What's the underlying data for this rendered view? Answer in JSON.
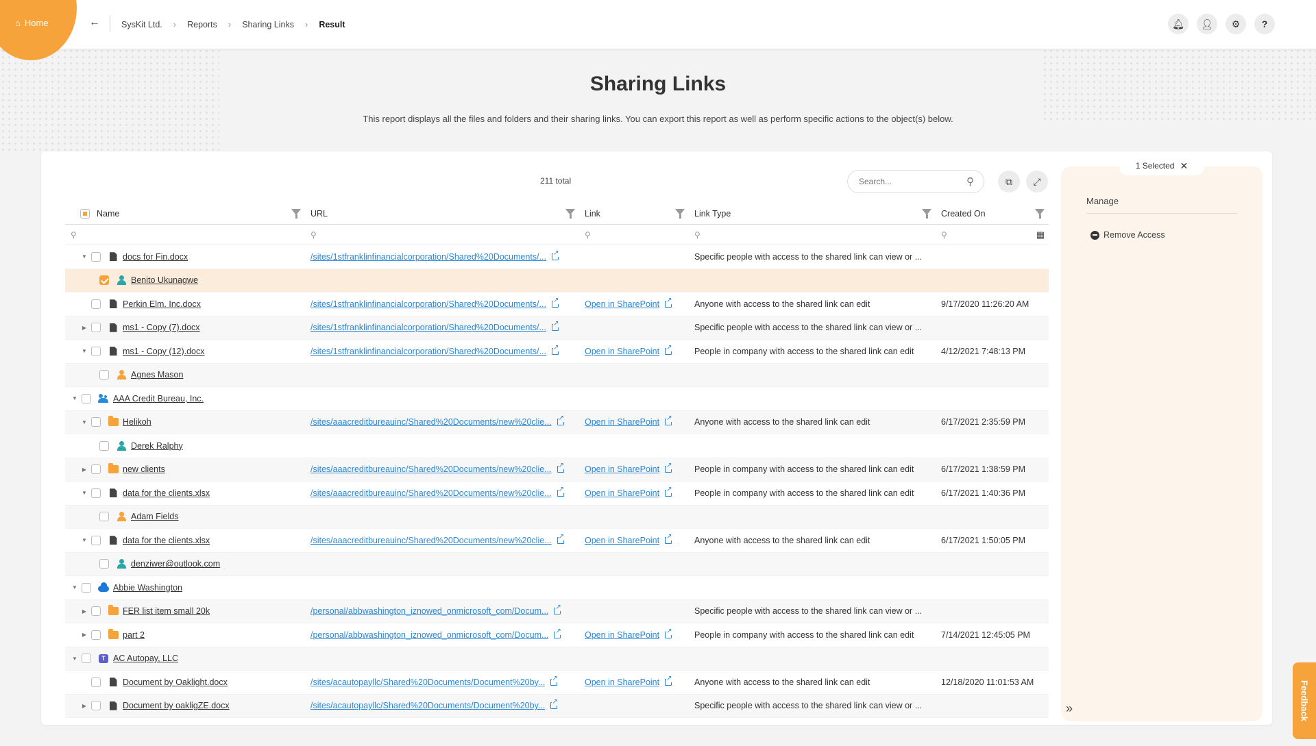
{
  "nav": {
    "home_label": "Home",
    "breadcrumb": [
      "SysKit Ltd.",
      "Reports",
      "Sharing Links",
      "Result"
    ]
  },
  "page": {
    "title": "Sharing Links",
    "description": "This report displays all the files and folders and their sharing links. You can export this report as well as perform specific actions to the object(s) below."
  },
  "toolbar": {
    "total": "211 total",
    "search_placeholder": "Search..."
  },
  "table": {
    "columns": [
      "Name",
      "URL",
      "Link",
      "Link Type",
      "Created On"
    ],
    "rows": [
      {
        "level": 1,
        "caret": "▼",
        "icon": "file",
        "name": "docs for Fin.docx",
        "url": "/sites/1stfranklinfinancialcorporation/Shared%20Documents/...",
        "link": "",
        "type": "Specific people with access to the shared link can view or ...",
        "date": "",
        "style": "normal"
      },
      {
        "level": 2,
        "caret": "",
        "icon": "user-teal",
        "name": "Benito Ukunagwe",
        "url": "",
        "link": "",
        "type": "",
        "date": "",
        "style": "sel",
        "checked": true
      },
      {
        "level": 1,
        "caret": "",
        "icon": "file",
        "name": "Perkin Elm. Inc.docx",
        "url": "/sites/1stfranklinfinancialcorporation/Shared%20Documents/...",
        "link": "Open in SharePoint",
        "type": "Anyone with access to the shared link can edit",
        "date": "9/17/2020 11:26:20 AM",
        "style": "normal"
      },
      {
        "level": 1,
        "caret": "▶",
        "icon": "file",
        "name": "ms1 - Copy (7).docx",
        "url": "/sites/1stfranklinfinancialcorporation/Shared%20Documents/...",
        "link": "",
        "type": "Specific people with access to the shared link can view or ...",
        "date": "",
        "style": "alt"
      },
      {
        "level": 1,
        "caret": "▼",
        "icon": "file",
        "name": "ms1 - Copy (12).docx",
        "url": "/sites/1stfranklinfinancialcorporation/Shared%20Documents/...",
        "link": "Open in SharePoint",
        "type": "People in company with access to the shared link can edit",
        "date": "4/12/2021 7:48:13 PM",
        "style": "normal"
      },
      {
        "level": 2,
        "caret": "",
        "icon": "user-orange",
        "name": "Agnes Mason",
        "url": "",
        "link": "",
        "type": "",
        "date": "",
        "style": "alt"
      },
      {
        "level": 0,
        "caret": "▼",
        "icon": "group",
        "name": "AAA Credit Bureau, Inc.",
        "url": "",
        "link": "",
        "type": "",
        "date": "",
        "style": "normal"
      },
      {
        "level": 1,
        "caret": "▼",
        "icon": "folder",
        "name": "Helikoh",
        "url": "/sites/aaacreditbureauinc/Shared%20Documents/new%20clie...",
        "link": "Open in SharePoint",
        "type": "Anyone with access to the shared link can edit",
        "date": "6/17/2021 2:35:59 PM",
        "style": "alt"
      },
      {
        "level": 2,
        "caret": "",
        "icon": "user-teal",
        "name": "Derek Ralphy",
        "url": "",
        "link": "",
        "type": "",
        "date": "",
        "style": "normal"
      },
      {
        "level": 1,
        "caret": "▶",
        "icon": "folder",
        "name": "new clients",
        "url": "/sites/aaacreditbureauinc/Shared%20Documents/new%20clie...",
        "link": "Open in SharePoint",
        "type": "People in company with access to the shared link can edit",
        "date": "6/17/2021 1:38:59 PM",
        "style": "alt"
      },
      {
        "level": 1,
        "caret": "▼",
        "icon": "file",
        "name": "data for the clients.xlsx",
        "url": "/sites/aaacreditbureauinc/Shared%20Documents/new%20clie...",
        "link": "Open in SharePoint",
        "type": "People in company with access to the shared link can edit",
        "date": "6/17/2021 1:40:36 PM",
        "style": "normal"
      },
      {
        "level": 2,
        "caret": "",
        "icon": "user-orange",
        "name": "Adam Fields",
        "url": "",
        "link": "",
        "type": "",
        "date": "",
        "style": "alt"
      },
      {
        "level": 1,
        "caret": "▼",
        "icon": "file",
        "name": "data for the clients.xlsx",
        "url": "/sites/aaacreditbureauinc/Shared%20Documents/new%20clie...",
        "link": "Open in SharePoint",
        "type": "Anyone with access to the shared link can edit",
        "date": "6/17/2021 1:50:05 PM",
        "style": "normal"
      },
      {
        "level": 2,
        "caret": "",
        "icon": "user-teal",
        "name": "denziwer@outlook.com",
        "url": "",
        "link": "",
        "type": "",
        "date": "",
        "style": "alt"
      },
      {
        "level": 0,
        "caret": "▼",
        "icon": "cloud",
        "name": "Abbie Washington",
        "url": "",
        "link": "",
        "type": "",
        "date": "",
        "style": "normal"
      },
      {
        "level": 1,
        "caret": "▶",
        "icon": "folder",
        "name": "FER list item small 20k",
        "url": "/personal/abbwashington_iznowed_onmicrosoft_com/Docum...",
        "link": "",
        "type": "Specific people with access to the shared link can view or ...",
        "date": "",
        "style": "alt"
      },
      {
        "level": 1,
        "caret": "▶",
        "icon": "folder",
        "name": "part 2",
        "url": "/personal/abbwashington_iznowed_onmicrosoft_com/Docum...",
        "link": "Open in SharePoint",
        "type": "People in company with access to the shared link can edit",
        "date": "7/14/2021 12:45:05 PM",
        "style": "normal"
      },
      {
        "level": 0,
        "caret": "▼",
        "icon": "teams",
        "name": "AC Autopay, LLC",
        "url": "",
        "link": "",
        "type": "",
        "date": "",
        "style": "alt"
      },
      {
        "level": 1,
        "caret": "",
        "icon": "file",
        "name": "Document by Oaklight.docx",
        "url": "/sites/acautopayllc/Shared%20Documents/Document%20by...",
        "link": "Open in SharePoint",
        "type": "Anyone with access to the shared link can edit",
        "date": "12/18/2020 11:01:53 AM",
        "style": "normal"
      },
      {
        "level": 1,
        "caret": "▶",
        "icon": "file",
        "name": "Document by oakligZE.docx",
        "url": "/sites/acautopayllc/Shared%20Documents/Document%20by...",
        "link": "",
        "type": "Specific people with access to the shared link can view or ...",
        "date": "",
        "style": "alt"
      }
    ]
  },
  "side_panel": {
    "selected_label": "1 Selected",
    "manage_heading": "Manage",
    "remove_access_label": "Remove Access"
  },
  "feedback_label": "Feedback",
  "colors": {
    "accent": "#f7a33b",
    "link": "#2a88d6",
    "selected_row": "#fcecdc",
    "panel_bg": "#fdf5ec",
    "user_teal": "#2aa6a6",
    "user_orange": "#f7a33b"
  }
}
